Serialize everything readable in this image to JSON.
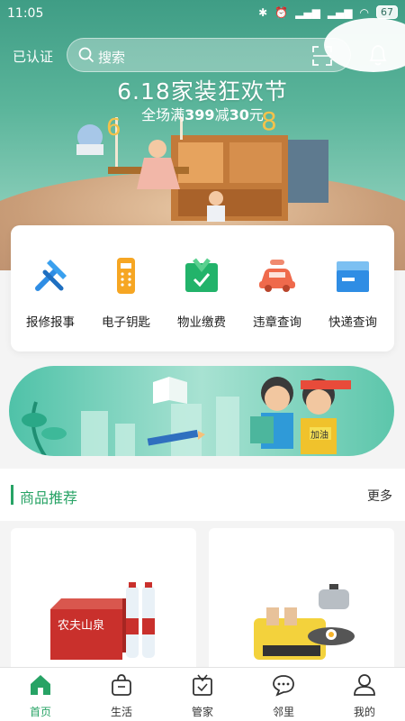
{
  "status_bar": {
    "time": "11:05",
    "battery": "67"
  },
  "header": {
    "verified_label": "已认证",
    "search_placeholder": "搜索"
  },
  "hero": {
    "headline": "6.18家装狂欢节",
    "sub_prefix": "全场满",
    "sub_amount1": "399",
    "sub_mid": "减",
    "sub_amount2": "30",
    "sub_suffix": "元"
  },
  "services": [
    {
      "label": "报修报事",
      "icon": "repair-tools-icon",
      "color": "#2f8de4"
    },
    {
      "label": "电子钥匙",
      "icon": "electronic-key-icon",
      "color": "#f6a623"
    },
    {
      "label": "物业缴费",
      "icon": "property-fee-icon",
      "color": "#22b36a"
    },
    {
      "label": "违章查询",
      "icon": "car-violation-icon",
      "color": "#ef6a4c"
    },
    {
      "label": "快递查询",
      "icon": "express-box-icon",
      "color": "#2f8de4"
    }
  ],
  "banner": {
    "badge_text": "加油"
  },
  "products_section": {
    "title": "商品推荐",
    "more": "更多"
  },
  "products": [
    {
      "image_icon": "water-bottles-product-icon",
      "brand_text": "农夫山泉"
    },
    {
      "image_icon": "breakfast-machine-product-icon"
    }
  ],
  "tabs": [
    {
      "label": "首页",
      "icon": "home-icon",
      "active": true
    },
    {
      "label": "生活",
      "icon": "shopping-bag-icon",
      "active": false
    },
    {
      "label": "管家",
      "icon": "butler-icon",
      "active": false
    },
    {
      "label": "邻里",
      "icon": "chat-icon",
      "active": false
    },
    {
      "label": "我的",
      "icon": "user-icon",
      "active": false
    }
  ],
  "colors": {
    "accent": "#27a365",
    "hero": "#4ea88f"
  }
}
